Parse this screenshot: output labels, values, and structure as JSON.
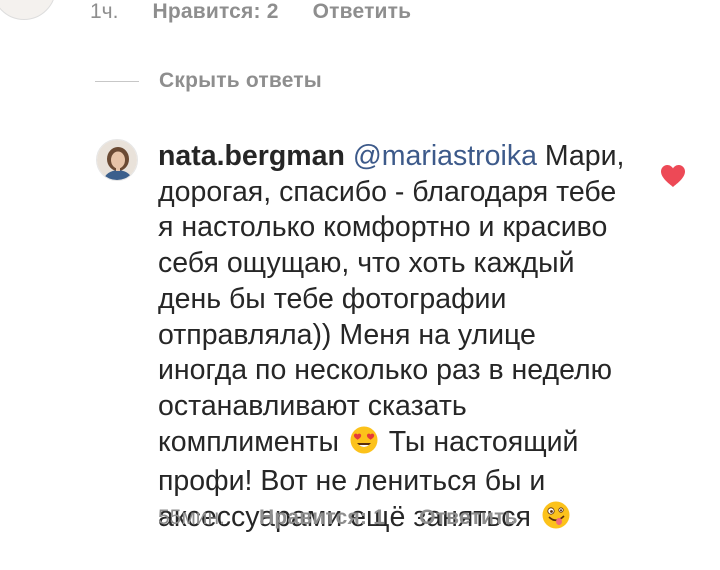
{
  "prev_comment": {
    "time": "1ч.",
    "likes": "Нравится: 2",
    "reply": "Ответить"
  },
  "hide_replies": "Скрыть ответы",
  "reply_comment": {
    "username": "nata.bergman",
    "mention": "@mariastroika",
    "text_part1": " Мари, дорогая, спасибо - благодаря тебе я настолько комфортно и красиво себя ощущаю, что хоть каждый день бы тебе фотографии отправляла)) Меня на улице иногда по несколько раз в неделю останавливают сказать комплименты ",
    "text_part2": " Ты настоящий профи! Вот не лениться бы и аксессуарами ещё заняться ",
    "emoji1": "heart-eyes-emoji",
    "emoji2": "zany-face-emoji",
    "liked": true,
    "time": "55мин.",
    "likes": "Нравится: 1",
    "reply": "Ответить"
  },
  "colors": {
    "heart": "#ed4956",
    "meta": "#8e8e8e",
    "mention": "#3d5a8a",
    "text": "#262626"
  }
}
